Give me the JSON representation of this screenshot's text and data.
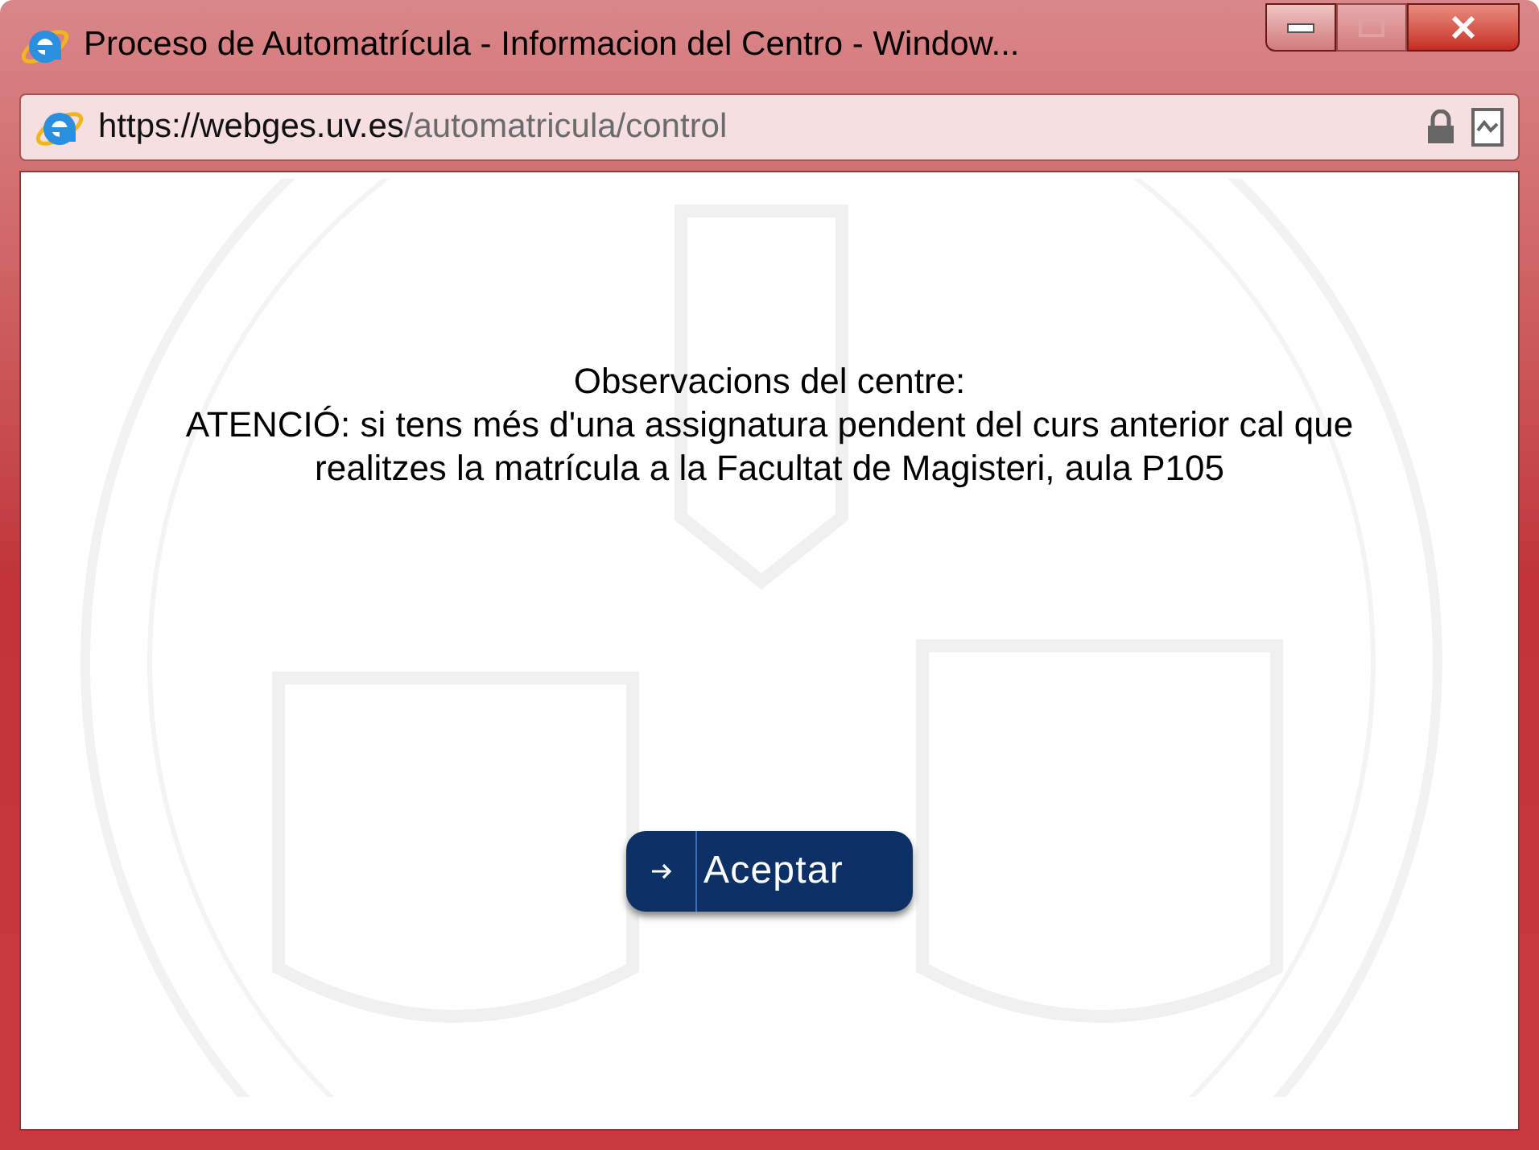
{
  "window": {
    "title": "Proceso de Automatrícula - Informacion del Centro - Window...",
    "controls": [
      {
        "kind": "minimize",
        "disabled": false
      },
      {
        "kind": "maximize",
        "disabled": true
      },
      {
        "kind": "close",
        "disabled": false
      }
    ]
  },
  "address_bar": {
    "host": "https://webges.uv.es",
    "path": "/automatricula/control",
    "secure": true
  },
  "content": {
    "heading": "Observacions del centre:",
    "message": "ATENCIÓ: si tens més d'una assignatura pendent del curs anterior cal que realitzes la matrícula a la Facultat de Magisteri, aula P105",
    "button": "Aceptar"
  }
}
